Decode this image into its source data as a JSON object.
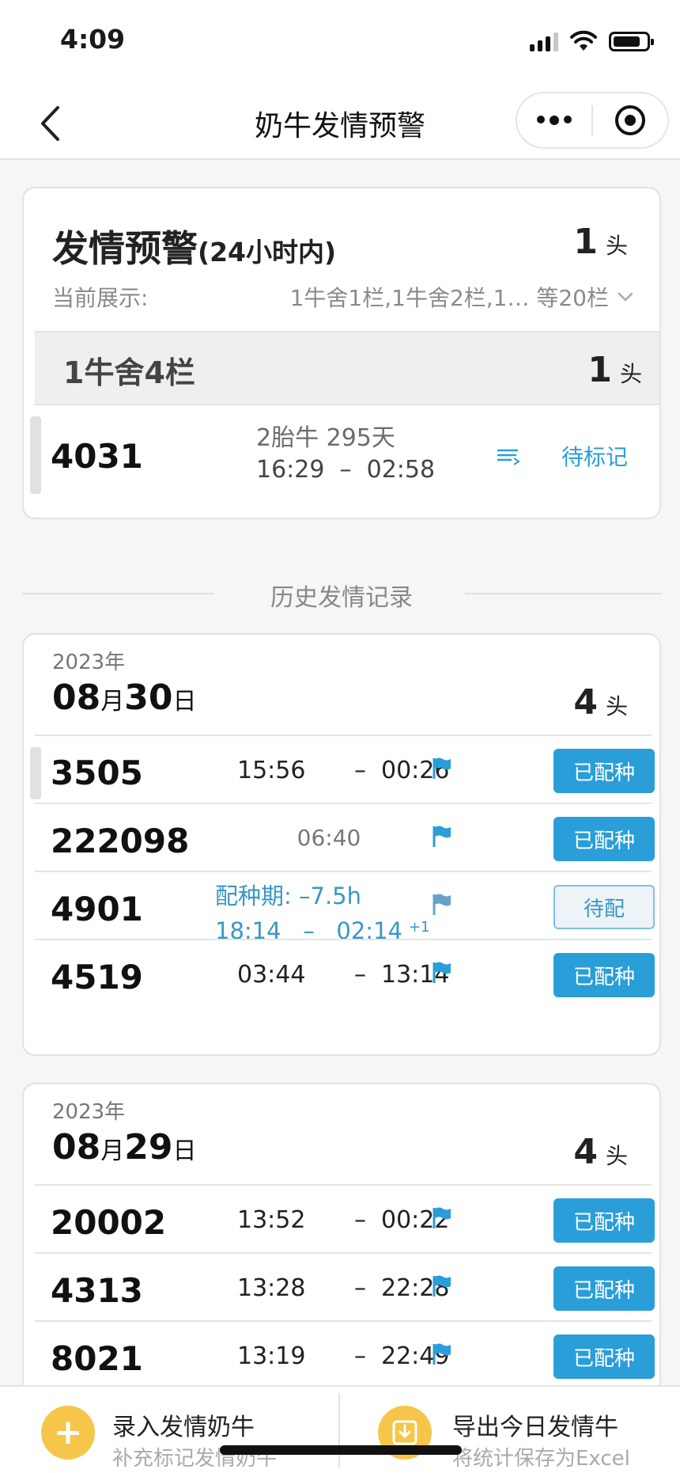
{
  "status_bar": {
    "time": "4:09"
  },
  "nav": {
    "title": "奶牛发情预警"
  },
  "alert_card": {
    "title": "发情预警",
    "subtitle": "(24小时内)",
    "count": "1",
    "unit": "头",
    "showing_label": "当前展示:",
    "showing_value": "1牛舍1栏,1牛舍2栏,1… 等20栏",
    "pen": {
      "name": "1牛舍4栏",
      "count": "1",
      "unit": "头"
    },
    "cow": {
      "id": "4031",
      "info": "2胎牛 295天",
      "start": "16:29",
      "end": "02:58",
      "dash": "–",
      "action": "待标记"
    }
  },
  "history": {
    "label": "历史发情记录",
    "days": [
      {
        "year": "2023年",
        "month": "08",
        "month_unit": "月",
        "day": "30",
        "day_unit": "日",
        "count": "4",
        "unit": "头",
        "rows": [
          {
            "id": "3505",
            "start": "15:56",
            "dash": "–",
            "end": "00:26",
            "status": "已配种"
          },
          {
            "id": "222098",
            "time": "06:40",
            "status": "已配种"
          },
          {
            "id": "4901",
            "period_label": "配种期: –7.5h",
            "start": "18:14",
            "dash": "–",
            "end": "02:14",
            "next_day": "+1",
            "status": "待配"
          },
          {
            "id": "4519",
            "start": "03:44",
            "dash": "–",
            "end": "13:14",
            "status": "已配种"
          }
        ]
      },
      {
        "year": "2023年",
        "month": "08",
        "month_unit": "月",
        "day": "29",
        "day_unit": "日",
        "count": "4",
        "unit": "头",
        "rows": [
          {
            "id": "20002",
            "start": "13:52",
            "dash": "–",
            "end": "00:22",
            "status": "已配种"
          },
          {
            "id": "4313",
            "start": "13:28",
            "dash": "–",
            "end": "22:28",
            "status": "已配种"
          },
          {
            "id": "8021",
            "start": "13:19",
            "dash": "–",
            "end": "22:49",
            "status": "已配种"
          }
        ]
      }
    ]
  },
  "bottom_bar": {
    "add": {
      "title": "录入发情奶牛",
      "subtitle": "补充标记发情奶牛"
    },
    "export": {
      "title": "导出今日发情牛",
      "subtitle": "将统计保存为Excel"
    }
  },
  "colors": {
    "accent": "#2a9ed8",
    "button_yellow": "#f6c64a"
  }
}
